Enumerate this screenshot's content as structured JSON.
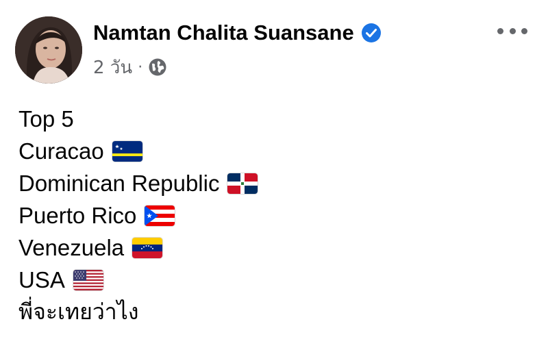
{
  "post": {
    "author": "Namtan Chalita Suansane",
    "verified": true,
    "time": "2 วัน",
    "separator": "·",
    "audience_icon": "globe-icon",
    "more_icon": "more-options-icon"
  },
  "content": {
    "heading": "Top 5",
    "countries": [
      {
        "name": "Curacao",
        "flag": "curacao-flag-icon"
      },
      {
        "name": "Dominican Republic",
        "flag": "dominican-republic-flag-icon"
      },
      {
        "name": "Puerto Rico",
        "flag": "puerto-rico-flag-icon"
      },
      {
        "name": "Venezuela",
        "flag": "venezuela-flag-icon"
      },
      {
        "name": "USA",
        "flag": "usa-flag-icon"
      }
    ],
    "closing": "พี่จะเทยว่าไง"
  },
  "colors": {
    "text": "#050505",
    "secondary": "#65676b",
    "verified": "#1b74e4"
  }
}
